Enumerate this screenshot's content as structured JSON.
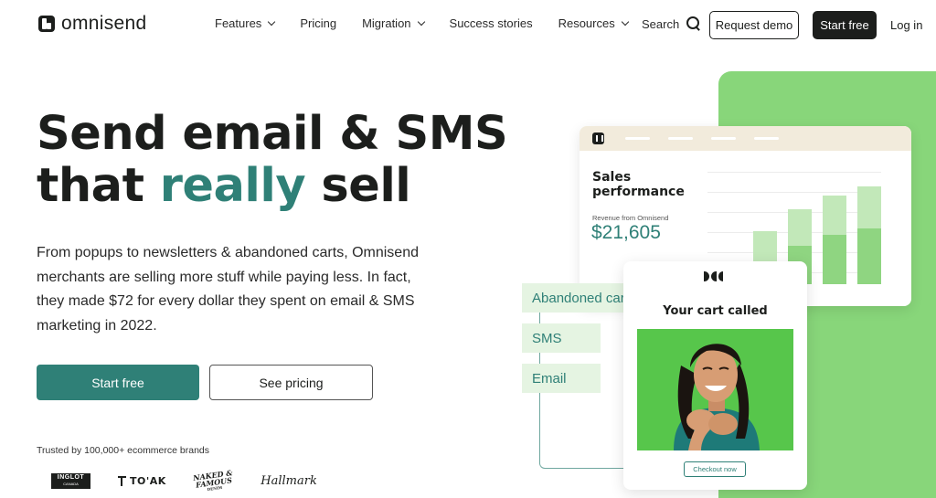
{
  "nav": {
    "logo_text": "omnisend",
    "menu": [
      {
        "label": "Features",
        "has_dropdown": true
      },
      {
        "label": "Pricing",
        "has_dropdown": false
      },
      {
        "label": "Migration",
        "has_dropdown": true
      },
      {
        "label": "Success stories",
        "has_dropdown": false
      },
      {
        "label": "Resources",
        "has_dropdown": true
      }
    ],
    "search_label": "Search",
    "request_demo": "Request demo",
    "start_free": "Start free",
    "login": "Log in"
  },
  "hero": {
    "headline_line1": "Send email & SMS",
    "headline_line2_pre": "that ",
    "headline_accent": "really",
    "headline_line2_post": " sell",
    "subtext": "From popups to newsletters & abandoned carts, Omnisend merchants are selling more stuff while paying less. In fact, they made $72 for every dollar they spent on email & SMS marketing in 2022.",
    "cta_primary": "Start free",
    "cta_secondary": "See pricing",
    "trusted_text": "Trusted by 100,000+ ecommerce brands",
    "brands": {
      "inglot_main": "INGLOT",
      "inglot_sub": "CANADA",
      "toak": "TO'AK",
      "naked_famous_line1": "NAKED &",
      "naked_famous_line2": "FAMOUS",
      "naked_famous_line3": "DENIM",
      "hallmark": "Hallmark"
    }
  },
  "illustration": {
    "sales_title_line1": "Sales",
    "sales_title_line2": "performance",
    "revenue_label": "Revenue from Omnisend",
    "revenue_value": "$21,605",
    "bars": [
      {
        "total": 0.14,
        "dark": 0.0
      },
      {
        "total": 0.48,
        "dark": 0.14
      },
      {
        "total": 0.68,
        "dark": 0.35
      },
      {
        "total": 0.81,
        "dark": 0.45
      },
      {
        "total": 0.89,
        "dark": 0.51
      }
    ],
    "tags": [
      "Abandoned cart",
      "SMS",
      "Email"
    ],
    "cart_title": "Your cart called",
    "checkout_label": "Checkout now",
    "colors": {
      "teal": "#2f8077",
      "green_bg": "#88d67a",
      "bar_light": "#c2e8b9",
      "bar_dark": "#8fd581",
      "photo_bg": "#57c64b"
    }
  }
}
